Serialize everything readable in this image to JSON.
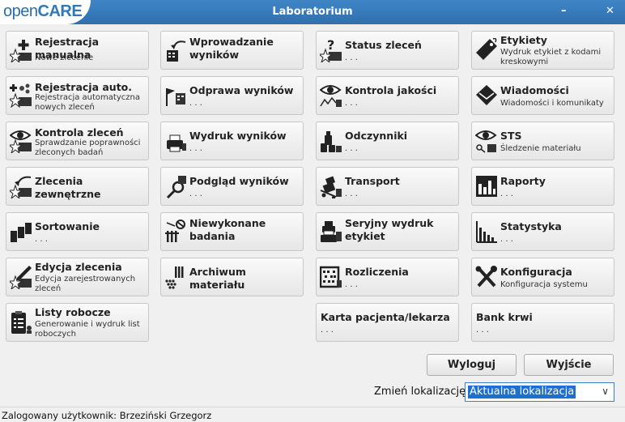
{
  "window": {
    "title": "Laboratorium",
    "logo_a": "open",
    "logo_b": "CARE",
    "minimize": "–",
    "close": "✕"
  },
  "tiles": [
    {
      "id": "rm",
      "label": "Rejestracja manualna",
      "sub": "Nowe zlecenie",
      "icon": "plus-star-icon"
    },
    {
      "id": "ra",
      "label": "Rejestracja auto.",
      "sub": "Rejestracja automatyczna nowych zleceń",
      "icon": "gear-plus-star-icon"
    },
    {
      "id": "kz",
      "label": "Kontrola zleceń",
      "sub": "Sprawdzanie poprawności zleconych badań",
      "icon": "eye-star-icon"
    },
    {
      "id": "zz",
      "label": "Zlecenia zewnętrzne",
      "sub": ". . .",
      "icon": "arrow-star-icon"
    },
    {
      "id": "so",
      "label": "Sortowanie",
      "sub": ". . .",
      "icon": "sort-blocks-icon"
    },
    {
      "id": "ez",
      "label": "Edycja zlecenia",
      "sub": "Edycja zarejestrowanych zleceń",
      "icon": "pencil-star-icon"
    },
    {
      "id": "lr",
      "label": "Listy robocze",
      "sub": "Generowanie i wydruk list roboczych",
      "icon": "clipboard-icon"
    },
    {
      "id": "ww",
      "label": "Wprowadzanie wyników",
      "sub": "",
      "icon": "arrow-tube-icon"
    },
    {
      "id": "ow",
      "label": "Odprawa wyników",
      "sub": ". . .",
      "icon": "flags-icon"
    },
    {
      "id": "dw",
      "label": "Wydruk wyników",
      "sub": ". . .",
      "icon": "printer-icon"
    },
    {
      "id": "pw",
      "label": "Podgląd wyników",
      "sub": ". . .",
      "icon": "magnifier-icon"
    },
    {
      "id": "nb",
      "label": "Niewykonane badania",
      "sub": "",
      "icon": "no-tubes-icon"
    },
    {
      "id": "am",
      "label": "Archiwum materiału",
      "sub": ". . .",
      "icon": "archive-icon"
    },
    {
      "id": "sz",
      "label": "Status zleceń",
      "sub": ". . .",
      "icon": "question-star-icon"
    },
    {
      "id": "kj",
      "label": "Kontrola jakości",
      "sub": ". . .",
      "icon": "eye-chart-icon"
    },
    {
      "id": "od",
      "label": "Odczynniki",
      "sub": ". . .",
      "icon": "reagents-icon"
    },
    {
      "id": "tr",
      "label": "Transport",
      "sub": ". . .",
      "icon": "cart-icon"
    },
    {
      "id": "sw",
      "label": "Seryjny wydruk etykiet",
      "sub": "",
      "icon": "label-printer-icon"
    },
    {
      "id": "rz",
      "label": "Rozliczenia",
      "sub": ". . .",
      "icon": "abacus-icon"
    },
    {
      "id": "kp",
      "label": "Karta pacjenta/lekarza",
      "sub": ". . .",
      "icon": ""
    },
    {
      "id": "et",
      "label": "Etykiety",
      "sub": "Wydruk etykiet z kodami kreskowymi",
      "icon": "tag-icon"
    },
    {
      "id": "wi",
      "label": "Wiadomości",
      "sub": "Wiadomości i komunikaty",
      "icon": "envelope-icon"
    },
    {
      "id": "st",
      "label": "STS",
      "sub": "Śledzenie materiału",
      "icon": "eye-key-icon"
    },
    {
      "id": "ra2",
      "label": "Raporty",
      "sub": ". . .",
      "icon": "report-chart-icon"
    },
    {
      "id": "sy",
      "label": "Statystyka",
      "sub": ". . .",
      "icon": "bar-chart-icon"
    },
    {
      "id": "ko",
      "label": "Konfiguracja",
      "sub": "Konfiguracja systemu",
      "icon": "tools-icon"
    },
    {
      "id": "bk",
      "label": "Bank krwi",
      "sub": ". . .",
      "icon": ""
    }
  ],
  "buttons": {
    "logout": "Wyloguj",
    "exit": "Wyjście"
  },
  "location": {
    "label": "Zmień lokalizację:",
    "value": "Aktualna lokalizacja"
  },
  "status": {
    "text": "Zalogowany użytkownik: Brzeziński Grzegorz"
  }
}
